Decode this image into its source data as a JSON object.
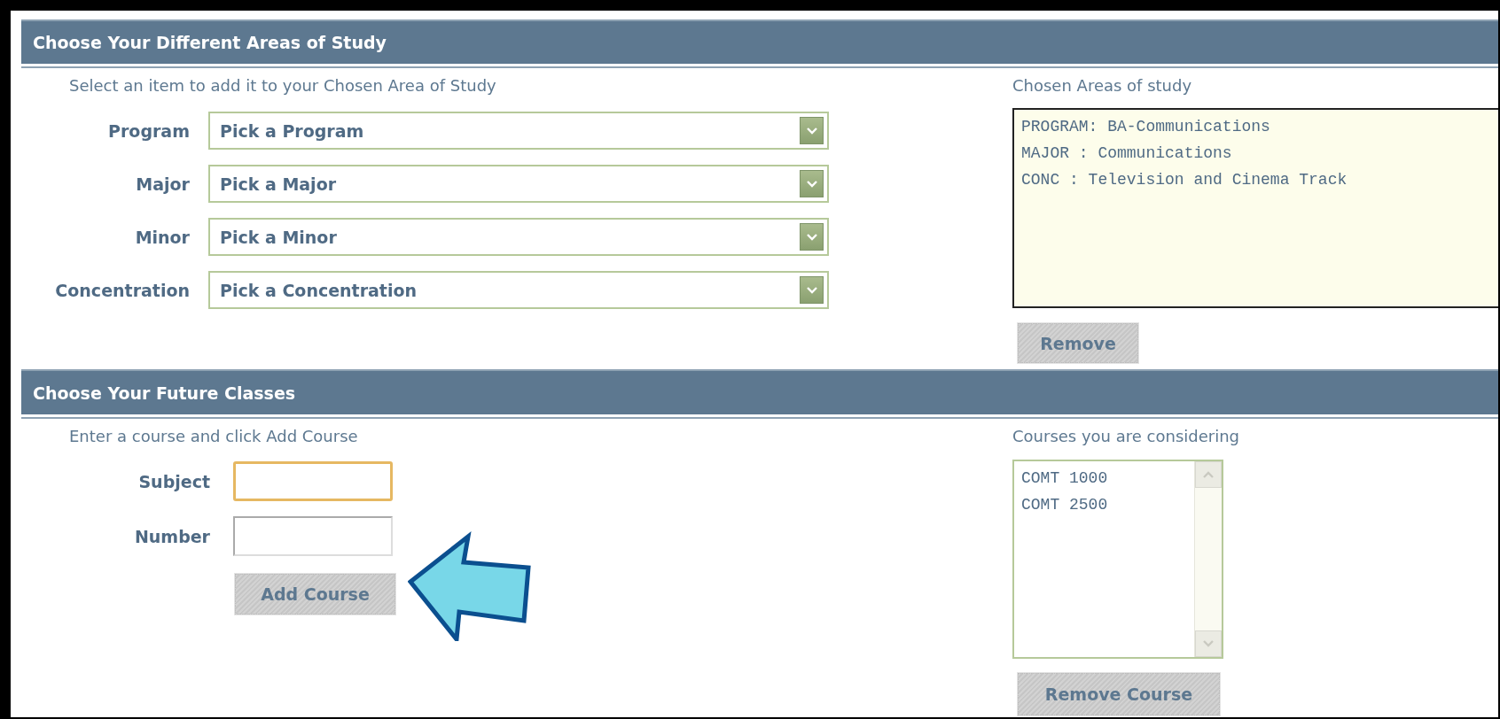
{
  "areas": {
    "title": "Choose Your Different Areas of Study",
    "hint": "Select an item to add it to your Chosen Area of Study",
    "selects": [
      {
        "label": "Program",
        "value": "Pick a Program"
      },
      {
        "label": "Major",
        "value": "Pick a Major"
      },
      {
        "label": "Minor",
        "value": "Pick a Minor"
      },
      {
        "label": "Concentration",
        "value": "Pick a Concentration"
      }
    ],
    "chosen": {
      "label": "Chosen Areas of study",
      "items": [
        "PROGRAM: BA-Communications",
        "MAJOR : Communications",
        "CONC : Television and Cinema Track"
      ]
    },
    "remove_button": "Remove"
  },
  "classes": {
    "title": "Choose Your Future Classes",
    "hint": "Enter a course and click Add Course",
    "fields": [
      {
        "label": "Subject",
        "focused": true
      },
      {
        "label": "Number",
        "focused": false
      }
    ],
    "add_button": "Add Course",
    "considering": {
      "label": "Courses you are considering",
      "items": [
        "COMT 1000",
        "COMT 2500"
      ]
    },
    "remove_button": "Remove Course"
  }
}
